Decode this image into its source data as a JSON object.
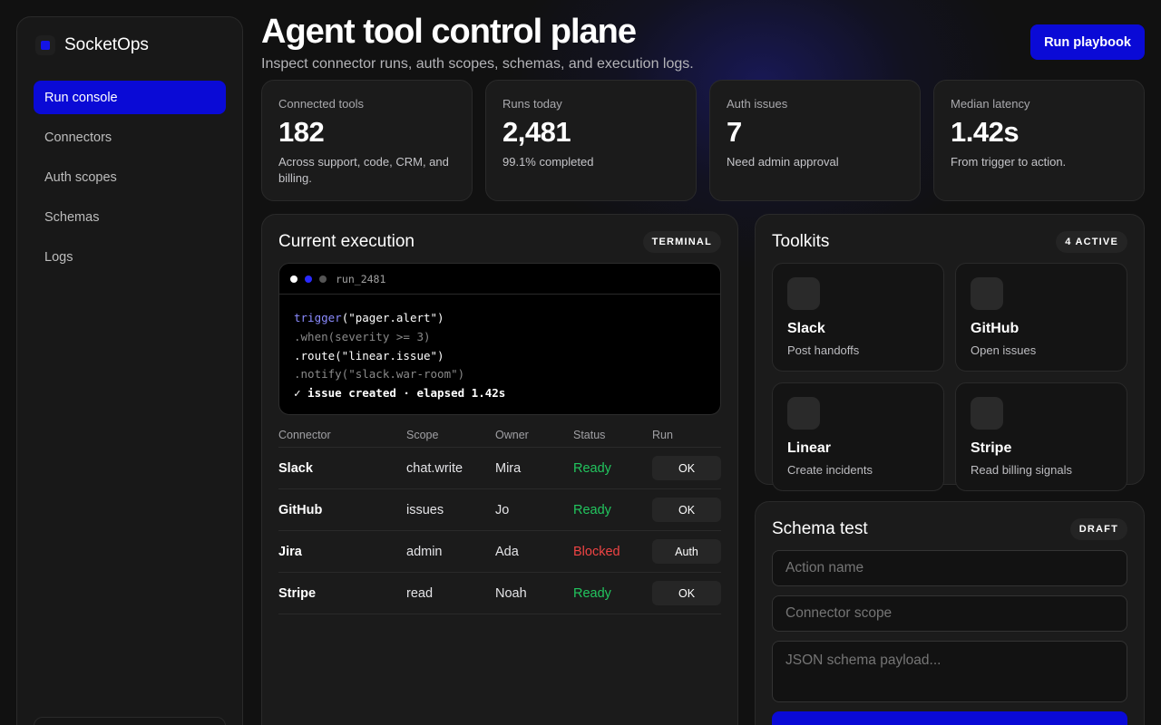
{
  "brand": {
    "name": "SocketOps"
  },
  "nav": [
    {
      "label": "Run console",
      "active": true
    },
    {
      "label": "Connectors",
      "active": false
    },
    {
      "label": "Auth scopes",
      "active": false
    },
    {
      "label": "Schemas",
      "active": false
    },
    {
      "label": "Logs",
      "active": false
    }
  ],
  "header": {
    "title": "Agent tool control plane",
    "subtitle": "Inspect connector runs, auth scopes, schemas, and execution logs.",
    "primary_action": "Run playbook"
  },
  "stats": [
    {
      "label": "Connected tools",
      "value": "182",
      "note": "Across support, code, CRM, and billing."
    },
    {
      "label": "Runs today",
      "value": "2,481",
      "note": "99.1% completed"
    },
    {
      "label": "Auth issues",
      "value": "7",
      "note": "Need admin approval"
    },
    {
      "label": "Median latency",
      "value": "1.42s",
      "note": "From trigger to action."
    }
  ],
  "execution": {
    "title": "Current execution",
    "badge": "TERMINAL",
    "terminal": {
      "run_id": "run_2481",
      "lines": {
        "l1_fn": "trigger",
        "l1_rest": "(\"pager.alert\")",
        "l2": ".when(severity >= 3)",
        "l3": ".route(\"linear.issue\")",
        "l4": ".notify(\"slack.war-room\")",
        "l5": "✓ issue created · elapsed 1.42s"
      }
    },
    "table": {
      "headers": {
        "connector": "Connector",
        "scope": "Scope",
        "owner": "Owner",
        "status": "Status",
        "run": "Run"
      },
      "rows": [
        {
          "connector": "Slack",
          "scope": "chat.write",
          "owner": "Mira",
          "status": "Ready",
          "run": "OK"
        },
        {
          "connector": "GitHub",
          "scope": "issues",
          "owner": "Jo",
          "status": "Ready",
          "run": "OK"
        },
        {
          "connector": "Jira",
          "scope": "admin",
          "owner": "Ada",
          "status": "Blocked",
          "run": "Auth"
        },
        {
          "connector": "Stripe",
          "scope": "read",
          "owner": "Noah",
          "status": "Ready",
          "run": "OK"
        }
      ]
    }
  },
  "toolkits": {
    "title": "Toolkits",
    "badge": "4 ACTIVE",
    "items": [
      {
        "name": "Slack",
        "desc": "Post handoffs"
      },
      {
        "name": "GitHub",
        "desc": "Open issues"
      },
      {
        "name": "Linear",
        "desc": "Create incidents"
      },
      {
        "name": "Stripe",
        "desc": "Read billing signals"
      }
    ]
  },
  "schema_test": {
    "title": "Schema test",
    "badge": "DRAFT",
    "action_placeholder": "Action name",
    "scope_placeholder": "Connector scope",
    "payload_placeholder": "JSON schema payload..."
  },
  "colors": {
    "accent": "#0a0ad6",
    "ready": "#22c55e",
    "blocked": "#ef4444",
    "terminal_dots": [
      "#ffffff",
      "#2a2aff",
      "#555555"
    ]
  }
}
